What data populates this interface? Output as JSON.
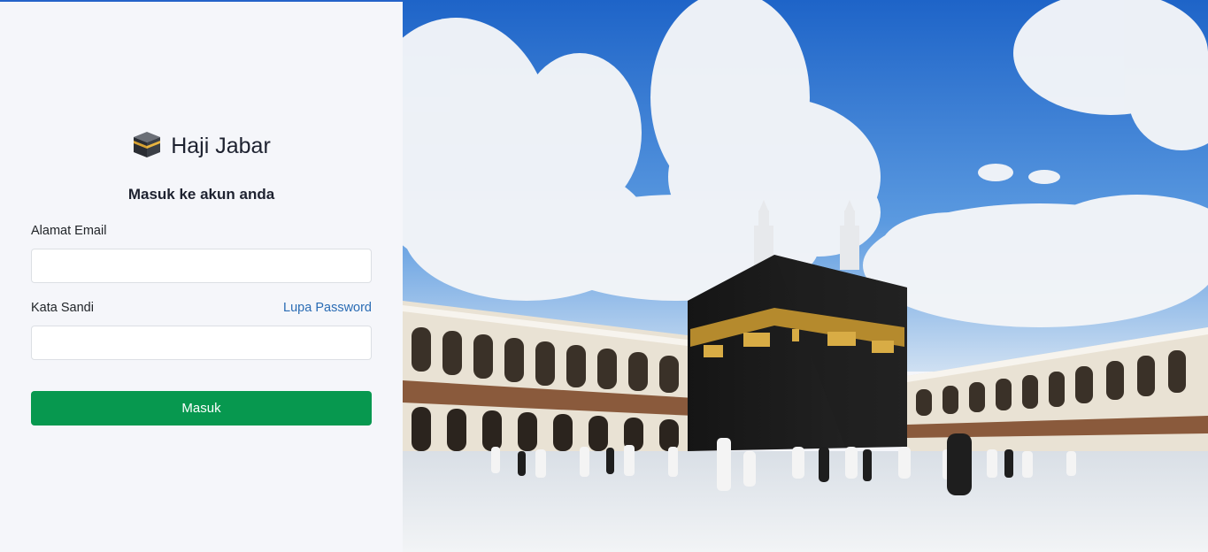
{
  "brand": {
    "title": "Haji Jabar",
    "icon": "kaaba-icon"
  },
  "login": {
    "subtitle": "Masuk ke akun anda",
    "email_label": "Alamat Email",
    "email_value": "",
    "email_placeholder": "",
    "password_label": "Kata Sandi",
    "password_value": "",
    "password_placeholder": "",
    "forgot_label": "Lupa Password",
    "submit_label": "Masuk"
  },
  "colors": {
    "accent": "#07984f",
    "link": "#2a6cb4",
    "top_bar": "#2563c9",
    "panel_bg": "#f5f6fa"
  },
  "hero": {
    "image": "kaaba-masjid-al-haram-photo"
  }
}
